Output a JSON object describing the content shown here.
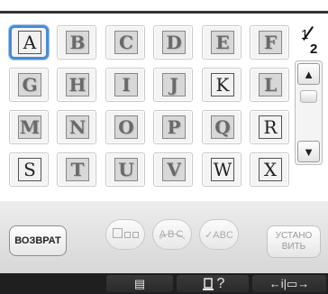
{
  "grid": {
    "rows": [
      [
        {
          "letter": "A",
          "style": "plain",
          "selected": true
        },
        {
          "letter": "B",
          "style": "deco",
          "selected": false
        },
        {
          "letter": "C",
          "style": "deco",
          "selected": false
        },
        {
          "letter": "D",
          "style": "deco",
          "selected": false
        },
        {
          "letter": "E",
          "style": "deco",
          "selected": false
        },
        {
          "letter": "F",
          "style": "deco",
          "selected": false
        }
      ],
      [
        {
          "letter": "G",
          "style": "deco",
          "selected": false
        },
        {
          "letter": "H",
          "style": "deco",
          "selected": false
        },
        {
          "letter": "I",
          "style": "deco",
          "selected": false
        },
        {
          "letter": "J",
          "style": "deco",
          "selected": false
        },
        {
          "letter": "K",
          "style": "plain",
          "selected": false
        },
        {
          "letter": "L",
          "style": "deco",
          "selected": false
        }
      ],
      [
        {
          "letter": "M",
          "style": "deco",
          "selected": false
        },
        {
          "letter": "N",
          "style": "deco",
          "selected": false
        },
        {
          "letter": "O",
          "style": "deco",
          "selected": false
        },
        {
          "letter": "P",
          "style": "deco",
          "selected": false
        },
        {
          "letter": "Q",
          "style": "deco",
          "selected": false
        },
        {
          "letter": "R",
          "style": "plain",
          "selected": false
        }
      ],
      [
        {
          "letter": "S",
          "style": "plain",
          "selected": false
        },
        {
          "letter": "T",
          "style": "deco",
          "selected": false
        },
        {
          "letter": "U",
          "style": "deco",
          "selected": false
        },
        {
          "letter": "V",
          "style": "deco",
          "selected": false
        },
        {
          "letter": "W",
          "style": "plain",
          "selected": false
        },
        {
          "letter": "X",
          "style": "plain",
          "selected": false
        }
      ]
    ]
  },
  "pager": {
    "current": "1",
    "total": "2"
  },
  "scroll": {
    "up_icon": "▲",
    "down_icon": "▼"
  },
  "buttons": {
    "back_label": "ВОЗВРАТ",
    "set_label_line1": "УСТАНО",
    "set_label_line2": "ВИТЬ",
    "layout_icon": "layout-boxes-icon",
    "arc_label": "ABC",
    "check_label": "✓ABC"
  },
  "statusbar": {
    "doc_icon": "▤",
    "help_label": "?",
    "help_icon": "spool-icon",
    "move_label": "←i|▭→"
  },
  "colors": {
    "selection": "#4b8bd6",
    "statusbar": "#1f1f1f"
  }
}
